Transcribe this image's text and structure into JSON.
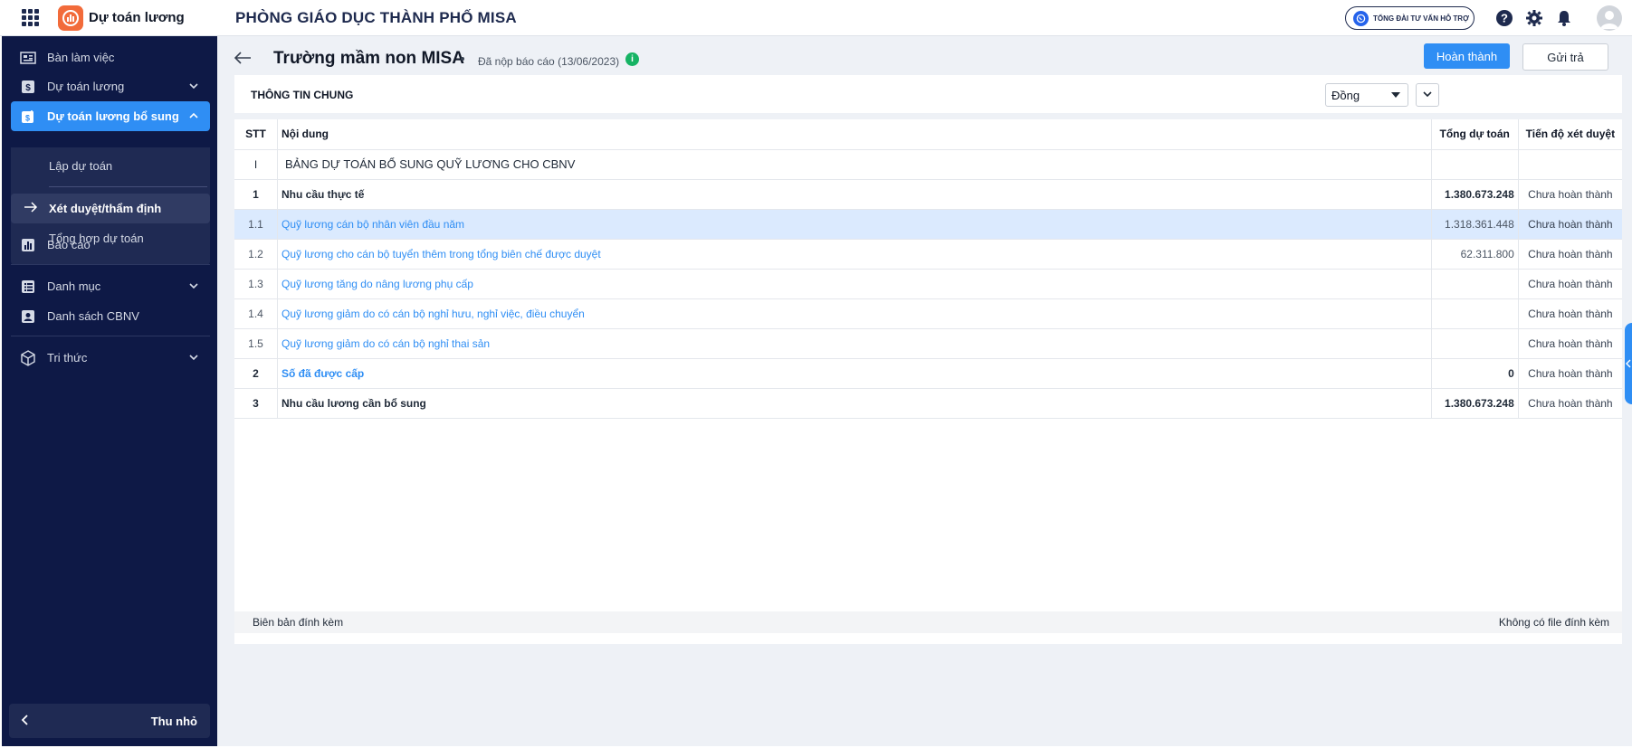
{
  "app": {
    "name": "Dự toán lương",
    "page_header": "PHÒNG GIÁO DỤC THÀNH PHỐ MISA",
    "hotline_label": "TỔNG ĐÀI TƯ VẤN HỖ TRỢ",
    "colors": {
      "sidebar": "#0e1946",
      "accent": "#2f8ef4",
      "logo": "#f26b3a"
    }
  },
  "sidebar": {
    "items": [
      {
        "label": "Bàn làm việc",
        "icon": "dashboard-icon"
      },
      {
        "label": "Dự toán lương",
        "icon": "money-icon",
        "expandable": true
      },
      {
        "label": "Dự toán lương bổ sung",
        "icon": "money-plus-icon",
        "expandable": true,
        "active": true
      },
      {
        "label": "Báo cáo",
        "icon": "chart-icon"
      },
      {
        "label": "Danh mục",
        "icon": "list-icon",
        "expandable": true
      },
      {
        "label": "Danh sách CBNV",
        "icon": "contact-icon"
      },
      {
        "label": "Tri thức",
        "icon": "cube-icon",
        "expandable": true
      }
    ],
    "sub_items": [
      {
        "label": "Lập dự toán"
      },
      {
        "label": "Xét duyệt/thẩm định",
        "current": true
      },
      {
        "label": "Tổng hợp dự toán"
      }
    ],
    "collapse_label": "Thu nhỏ"
  },
  "main": {
    "title": "Trường mầm non MISA",
    "status": "Đã nộp báo cáo (13/06/2023)",
    "complete_button": "Hoàn thành",
    "return_button": "Gửi trả",
    "section_title": "THÔNG TIN CHUNG",
    "unit_select": "Đồng",
    "table": {
      "headers": {
        "stt": "STT",
        "content": "Nội dung",
        "total": "Tổng dự toán",
        "progress": "Tiến độ xét duyệt"
      },
      "rows": [
        {
          "stt": "I",
          "content": "BẢNG DỰ TOÁN BỔ SUNG QUỸ LƯƠNG CHO CBNV",
          "total": "",
          "progress": ""
        },
        {
          "stt": "1",
          "content": "Nhu cầu thực tế",
          "total": "1.380.673.248",
          "progress": "Chưa hoàn thành"
        },
        {
          "stt": "1.1",
          "content": "Quỹ lương cán bộ nhân viên đầu năm",
          "total": "1.318.361.448",
          "progress": "Chưa hoàn thành"
        },
        {
          "stt": "1.2",
          "content": "Quỹ lương cho cán bộ tuyển thêm trong tổng biên chế được duyệt",
          "total": "62.311.800",
          "progress": "Chưa hoàn thành"
        },
        {
          "stt": "1.3",
          "content": "Quỹ lương tăng do nâng lương phụ cấp",
          "total": "",
          "progress": "Chưa hoàn thành"
        },
        {
          "stt": "1.4",
          "content": "Quỹ lương giảm do có cán bộ nghỉ hưu, nghỉ việc, điều chuyển",
          "total": "",
          "progress": "Chưa hoàn thành"
        },
        {
          "stt": "1.5",
          "content": "Quỹ lương giảm do có cán bộ nghỉ thai sản",
          "total": "",
          "progress": "Chưa hoàn thành"
        },
        {
          "stt": "2",
          "content": "Số đã được cấp",
          "total": "0",
          "progress": "Chưa hoàn thành"
        },
        {
          "stt": "3",
          "content": "Nhu cầu lương cần bổ sung",
          "total": "1.380.673.248",
          "progress": "Chưa hoàn thành"
        }
      ]
    },
    "attachment_label": "Biên bản đính kèm",
    "attachment_status": "Không có file đính kèm"
  }
}
